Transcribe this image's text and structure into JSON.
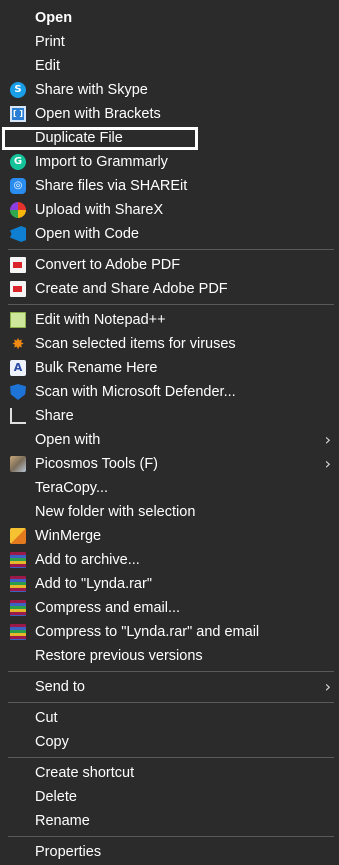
{
  "menu": {
    "items": [
      {
        "label": "Open",
        "icon": "",
        "bold": true
      },
      {
        "label": "Print",
        "icon": ""
      },
      {
        "label": "Edit",
        "icon": ""
      },
      {
        "label": "Share with Skype",
        "icon": "skype-icon"
      },
      {
        "label": "Open with Brackets",
        "icon": "brackets-icon"
      },
      {
        "label": "Duplicate File",
        "icon": "",
        "highlighted": true
      },
      {
        "label": "Import to Grammarly",
        "icon": "grammarly-icon"
      },
      {
        "label": "Share files via SHAREit",
        "icon": "shareit-icon"
      },
      {
        "label": "Upload with ShareX",
        "icon": "sharex-icon"
      },
      {
        "label": "Open with Code",
        "icon": "vscode-icon"
      },
      {
        "separator": true
      },
      {
        "label": "Convert to Adobe PDF",
        "icon": "adobe-pdf-icon"
      },
      {
        "label": "Create and Share Adobe PDF",
        "icon": "adobe-pdf-icon"
      },
      {
        "separator": true
      },
      {
        "label": "Edit with Notepad++",
        "icon": "notepadpp-icon"
      },
      {
        "label": "Scan selected items for viruses",
        "icon": "virus-scan-icon"
      },
      {
        "label": "Bulk Rename Here",
        "icon": "bulk-rename-icon"
      },
      {
        "label": "Scan with Microsoft Defender...",
        "icon": "defender-shield-icon"
      },
      {
        "label": "Share",
        "icon": "share-icon"
      },
      {
        "label": "Open with",
        "icon": "",
        "submenu": true
      },
      {
        "label": "Picosmos Tools (F)",
        "icon": "picosmos-icon",
        "submenu": true
      },
      {
        "label": "TeraCopy...",
        "icon": ""
      },
      {
        "label": "New folder with selection",
        "icon": ""
      },
      {
        "label": "WinMerge",
        "icon": "winmerge-icon"
      },
      {
        "label": "Add to archive...",
        "icon": "winrar-icon"
      },
      {
        "label": "Add to \"Lynda.rar\"",
        "icon": "winrar-icon"
      },
      {
        "label": "Compress and email...",
        "icon": "winrar-icon"
      },
      {
        "label": "Compress to \"Lynda.rar\" and email",
        "icon": "winrar-icon"
      },
      {
        "label": "Restore previous versions",
        "icon": ""
      },
      {
        "separator": true
      },
      {
        "label": "Send to",
        "icon": "",
        "submenu": true
      },
      {
        "separator": true
      },
      {
        "label": "Cut",
        "icon": ""
      },
      {
        "label": "Copy",
        "icon": ""
      },
      {
        "separator": true
      },
      {
        "label": "Create shortcut",
        "icon": ""
      },
      {
        "label": "Delete",
        "icon": ""
      },
      {
        "label": "Rename",
        "icon": ""
      },
      {
        "separator": true
      },
      {
        "label": "Properties",
        "icon": ""
      }
    ],
    "submenu_glyph": "›"
  },
  "colors": {
    "background": "#2b2b2b",
    "text": "#ffffff",
    "separator": "#5a5a5a",
    "highlight_border": "#ffffff"
  }
}
